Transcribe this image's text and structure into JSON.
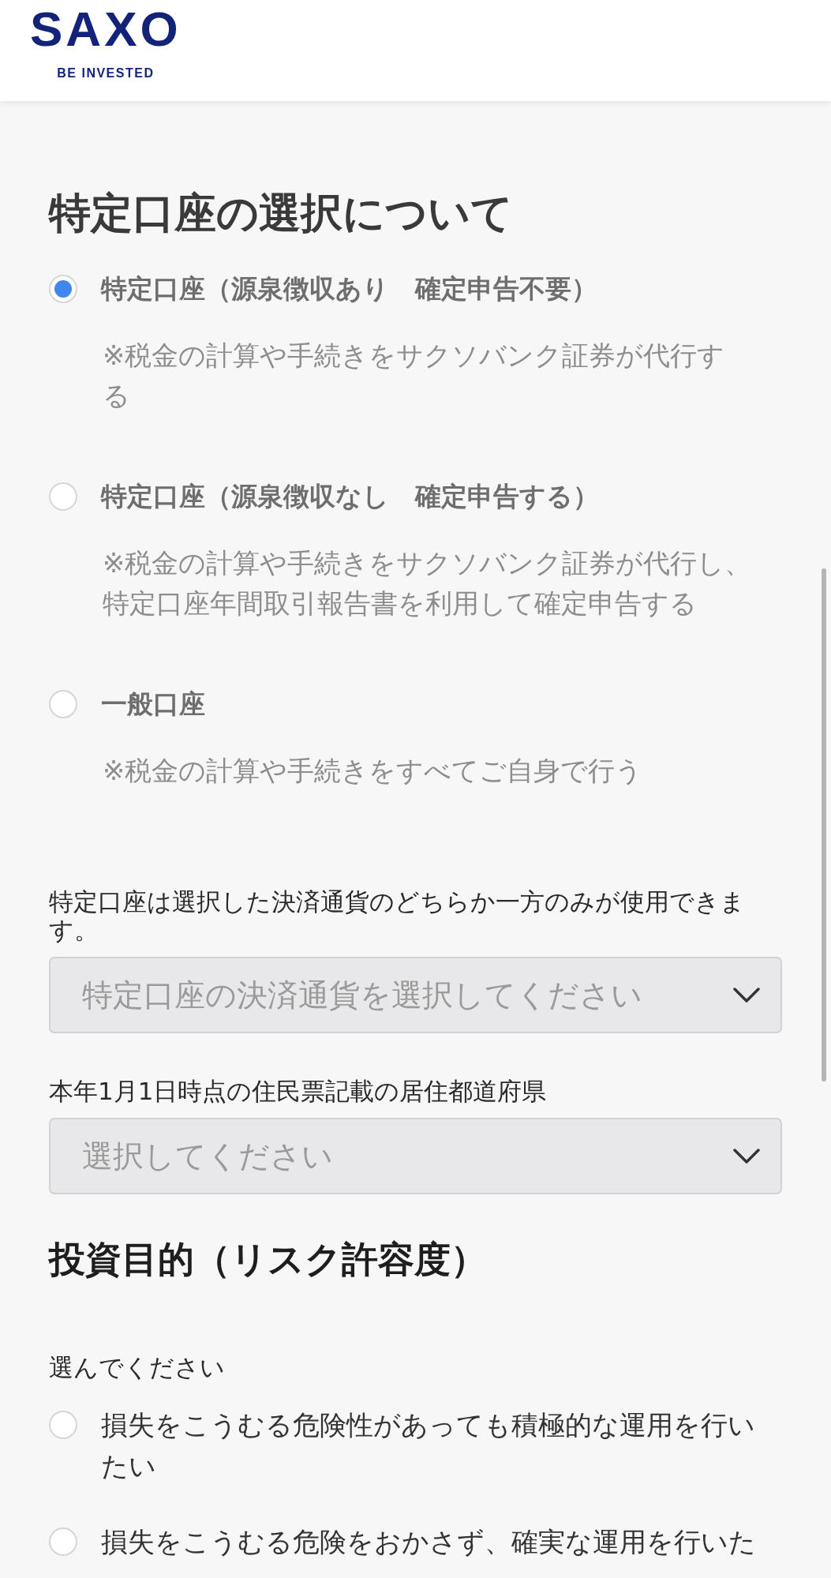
{
  "header": {
    "logo": "SAXO",
    "tagline": "BE INVESTED"
  },
  "account_section": {
    "title": "特定口座の選択について",
    "options": [
      {
        "label": "特定口座（源泉徴収あり　確定申告不要）",
        "note": "※税金の計算や手続きをサクソバンク証券が代行する",
        "selected": true
      },
      {
        "label": "特定口座（源泉徴収なし　確定申告する）",
        "note": "※税金の計算や手続きをサクソバンク証券が代行し、特定口座年間取引報告書を利用して確定申告する",
        "selected": false
      },
      {
        "label": "一般口座",
        "note": "※税金の計算や手続きをすべてご自身で行う",
        "selected": false
      }
    ]
  },
  "currency": {
    "label": "特定口座は選択した決済通貨のどちらか一方のみが使用できます。",
    "placeholder": "特定口座の決済通貨を選択してください"
  },
  "prefecture": {
    "label": "本年1月1日時点の住民票記載の居住都道府県",
    "placeholder": "選択してください"
  },
  "risk_section": {
    "title": "投資目的（リスク許容度）",
    "prompt": "選んでください",
    "options": [
      {
        "label": "損失をこうむる危険性があっても積極的な運用を行いたい",
        "selected": false
      },
      {
        "label": "損失をこうむる危険をおかさず、確実な運用を行いた",
        "selected": false
      }
    ]
  }
}
